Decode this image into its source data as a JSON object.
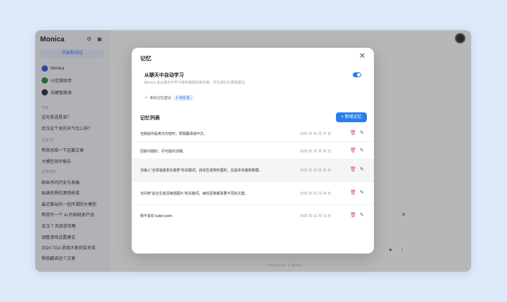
{
  "sidebar": {
    "brand": "Monica",
    "new_chat": "开始新对话",
    "agents": [
      {
        "label": "Monica",
        "icon": "monica-icon",
        "color": "#3b5bdb"
      },
      {
        "label": "UI交案助手",
        "icon": "ui-assistant-icon",
        "color": "#2f8a3e"
      },
      {
        "label": "创建智能体",
        "icon": "create-agent-icon",
        "color": "#333333"
      }
    ],
    "sections": [
      "今天",
      "过去7天",
      "过去30天"
    ],
    "history": [
      "这句英语是谁？",
      "武汉这个关的天气怎么样？",
      "帮我总结一下这篇文章",
      "大模型测评报告",
      "剧本杀的历史与发展",
      "画满世界的港铁桥梁",
      "最近推出的一些所谓的大模型",
      "帮我写一个 AI 的相机前产品",
      "武汉 7 天旅游攻略",
      "调整游戏设置建议",
      "2024 TGA 游戏大家获奖名单",
      "帮我翻译这个文章"
    ]
  },
  "main": {
    "footer": "Powered by ✦ Monica"
  },
  "modal": {
    "title": "记忆",
    "auto_learn": {
      "title": "从聊天中自动学习",
      "desc": "Monica 会从聊天中学习和存储相关到问答，并生成记忆更新建议。",
      "enabled": true
    },
    "suggest": {
      "label": "新的记忆建议",
      "badge": "5 待处理 ›"
    },
    "list_title": "记忆列表",
    "add_button": "+ 新增记忆",
    "items": [
      {
        "text": "当我给你是英文内容时，帮我翻译成中文。",
        "date": "2025 年 02 月 07 日"
      },
      {
        "text": "回答问题时，尽可能的详细。",
        "date": "2025 年 02 月 06 日"
      },
      {
        "text": "当输入\"全球温度变化趋势\"的关键词，自动生成地形图形。且是本年最新数据。",
        "date": "2025 年 02 月 05 日"
      },
      {
        "text": "当问到\"适合生成清晰插图片\"的关键词，每轮回答都需要不同的文案。",
        "date": "2025 年 02 月 04 日"
      },
      {
        "text": "我不喜欢 bullet point",
        "date": "2025 年 02 月 03 日"
      }
    ]
  },
  "colors": {
    "accent": "#2b7de9",
    "delete": "#e55353"
  }
}
